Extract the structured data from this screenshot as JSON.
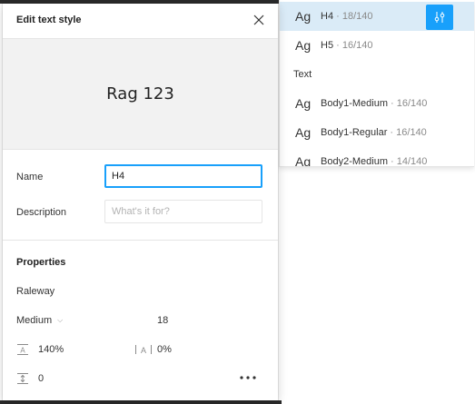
{
  "dialog": {
    "title": "Edit text style",
    "preview_text": "Rag 123",
    "name_label": "Name",
    "name_value": "H4",
    "description_label": "Description",
    "description_placeholder": "What's it for?",
    "properties_title": "Properties",
    "font_family": "Raleway",
    "font_weight": "Medium",
    "font_size": "18",
    "line_height": "140%",
    "letter_spacing": "0%",
    "paragraph_spacing": "0"
  },
  "style_list": {
    "items": [
      {
        "ag": "Ag",
        "name": "H4",
        "size": " · 18/140",
        "selected": true
      },
      {
        "ag": "Ag",
        "name": "H5",
        "size": " · 16/140",
        "selected": false
      }
    ],
    "section": "Text",
    "text_items": [
      {
        "ag": "Ag",
        "name": "Body1-Medium",
        "size": " · 16/140"
      },
      {
        "ag": "Ag",
        "name": "Body1-Regular",
        "size": " · 16/140"
      },
      {
        "ag": "Ag",
        "name": "Body2-Medium",
        "size": " · 14/140"
      }
    ]
  },
  "colors": {
    "accent": "#18a0fb",
    "selected_row": "#daebf7"
  }
}
